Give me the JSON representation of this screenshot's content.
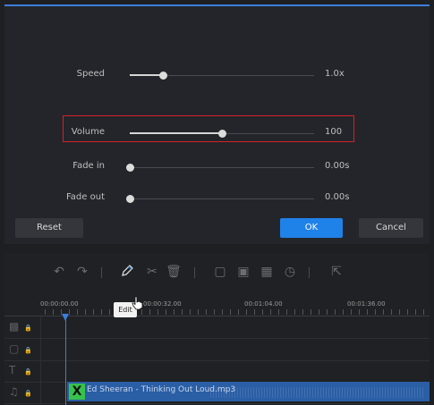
{
  "dialog": {
    "speed": {
      "label": "Speed",
      "value": "1.0x",
      "fraction": 0.18
    },
    "volume": {
      "label": "Volume",
      "value": "100",
      "fraction": 0.5
    },
    "fade_in": {
      "label": "Fade in",
      "value": "0.00s",
      "fraction": 0.0
    },
    "fade_out": {
      "label": "Fade out",
      "value": "0.00s",
      "fraction": 0.0
    },
    "buttons": {
      "reset": "Reset",
      "ok": "OK",
      "cancel": "Cancel"
    },
    "highlight_color": "#d3212a",
    "accent": "#1f82e8"
  },
  "timeline": {
    "tooltip": "Edit",
    "ruler": [
      "00:00:00.00",
      "00:00:32.00",
      "00:01:04.00",
      "00:01:36.00"
    ],
    "audio_clip": {
      "name": "Ed Sheeran - Thinking Out Loud.mp3",
      "icon": "x-icon"
    },
    "toolbar_icons": [
      "undo-icon",
      "redo-icon",
      "pencil-icon",
      "cut-icon",
      "trash-icon",
      "crop-icon",
      "frame-icon",
      "mosaic-icon",
      "clock-icon",
      "export-icon"
    ],
    "tracks": [
      "video-track",
      "image-track",
      "text-track",
      "music-track"
    ]
  }
}
